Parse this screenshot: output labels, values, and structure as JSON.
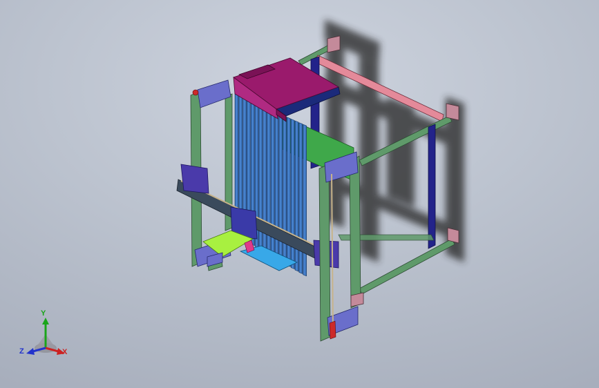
{
  "viewport": {
    "background_top": "#cdd3de",
    "background_bottom": "#a7aebc"
  },
  "triad": {
    "x_label": "X",
    "y_label": "Y",
    "z_label": "Z",
    "x_color": "#cc2222",
    "y_color": "#1aa51a",
    "z_color": "#2233cc"
  },
  "model": {
    "part_colors": {
      "frame_posts": "#5f9a6a",
      "hopper": "#9a1a6c",
      "fins": "#3e7ac8",
      "top_rail": "#e48a9a",
      "green_panel": "#3fa84a",
      "plates": "#6a6ecb",
      "dark_posts": "#23238a",
      "gantry_beam": "#3a4a5c",
      "carriage_plate": "#a8f040",
      "base_tray": "#38a8e8"
    }
  }
}
